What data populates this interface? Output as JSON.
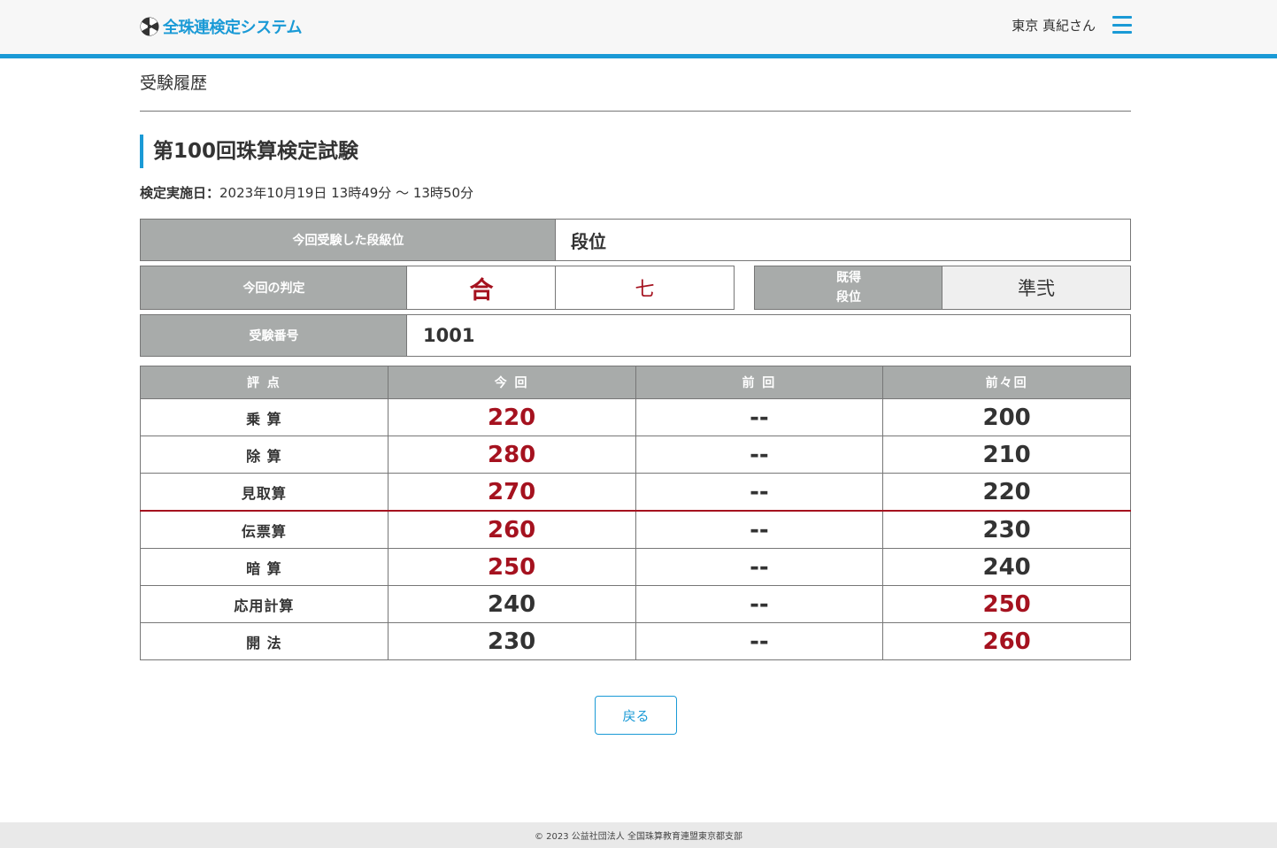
{
  "header": {
    "logo_text": "全珠連検定システム",
    "user_name": "東京 真紀さん",
    "accent_color": "#1a9ad6"
  },
  "page": {
    "heading": "受験履歴"
  },
  "exam": {
    "title": "第100回珠算検定試験",
    "date_label": "検定実施日：",
    "date_value": "2023年10月19日 13時49分 ～ 13時50分"
  },
  "info": {
    "grade_label": "今回受験した段級位",
    "grade_value": "段位",
    "result_label": "今回の判定",
    "result_value": "合",
    "result_rank": "七",
    "held_label_line1": "既得",
    "held_label_line2": "段位",
    "held_value": "準弐",
    "exam_number_label": "受験番号",
    "exam_number_value": "1001"
  },
  "scores": {
    "headers": [
      "評 点",
      "今 回",
      "前 回",
      "前々回"
    ],
    "rows": [
      {
        "subject": "乗 算",
        "current": "220",
        "previous": "--",
        "before_previous": "200"
      },
      {
        "subject": "除 算",
        "current": "280",
        "previous": "--",
        "before_previous": "210"
      },
      {
        "subject": "見取算",
        "current": "270",
        "previous": "--",
        "before_previous": "220"
      },
      {
        "subject": "伝票算",
        "current": "260",
        "previous": "--",
        "before_previous": "230"
      },
      {
        "subject": "暗 算",
        "current": "250",
        "previous": "--",
        "before_previous": "240"
      },
      {
        "subject": "応用計算",
        "current": "240",
        "previous": "--",
        "before_previous": "250"
      },
      {
        "subject": "開 法",
        "current": "230",
        "previous": "--",
        "before_previous": "260"
      }
    ],
    "highlight_color": "#a5121f"
  },
  "actions": {
    "back_label": "戻る"
  },
  "footer": {
    "copyright": "© 2023 公益社団法人 全国珠算教育連盟東京都支部"
  }
}
